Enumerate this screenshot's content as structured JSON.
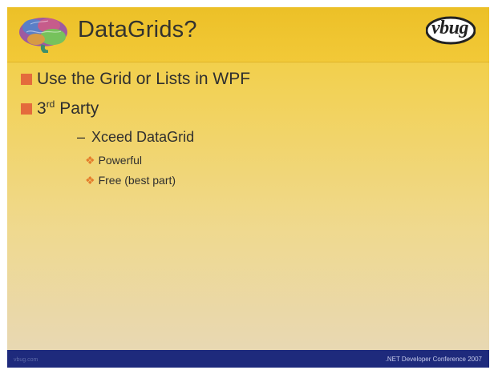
{
  "slide": {
    "title": "DataGrids?",
    "logo": "vbug",
    "bullets": [
      {
        "text": "Use the Grid or Lists in WPF"
      },
      {
        "pre": "3",
        "sup": "rd",
        "post": " Party"
      }
    ],
    "sub_bullets": [
      {
        "text": "Xceed DataGrid"
      }
    ],
    "sub_sub_bullets": [
      {
        "text": "Powerful"
      },
      {
        "text": "Free (best part)"
      }
    ],
    "footer_left": "vbug.com",
    "footer_right": ".NET Developer Conference 2007"
  },
  "colors": {
    "title_band": "#f2c938",
    "bullet_square": "#e46b3c",
    "diamond": "#e47c2b",
    "footer": "#1e2a7c"
  },
  "icons": {
    "brain": "brain-icon",
    "logo": "vbug-logo"
  }
}
